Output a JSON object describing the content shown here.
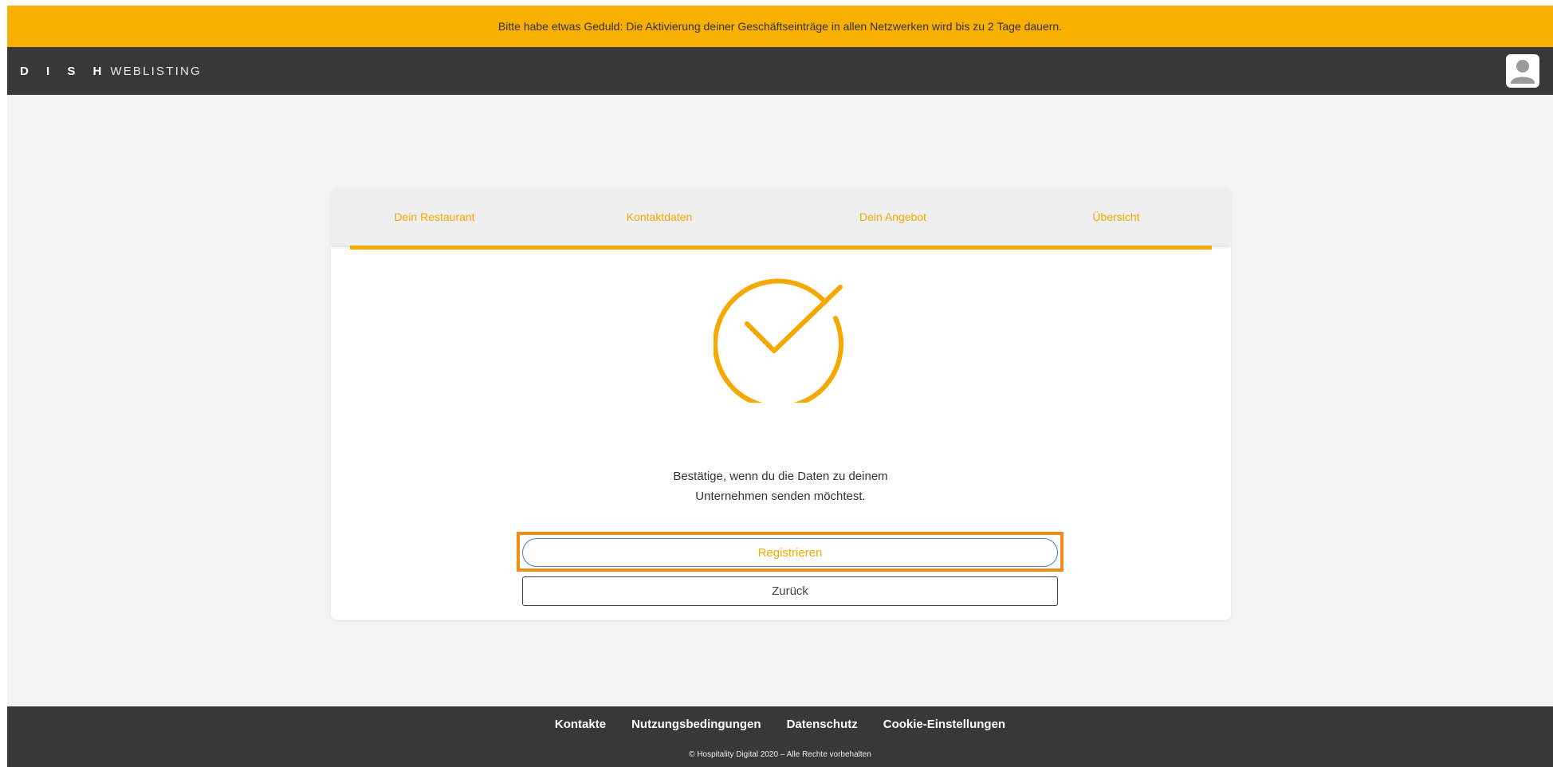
{
  "notice": {
    "text": "Bitte habe etwas Geduld: Die Aktivierung deiner Geschäftseinträge in allen Netzwerken wird bis zu 2 Tage dauern."
  },
  "header": {
    "brand": "D I S H",
    "product": "WEBLISTING",
    "avatar_icon": "user-icon"
  },
  "steps": [
    {
      "label": "Dein Restaurant"
    },
    {
      "label": "Kontaktdaten"
    },
    {
      "label": "Dein Angebot"
    },
    {
      "label": "Übersicht"
    }
  ],
  "progress": {
    "completed_fraction": 1.0
  },
  "success_icon": "checkmark-circle-icon",
  "confirm": {
    "line1": "Bestätige, wenn du die Daten zu deinem",
    "line2": "Unternehmen senden möchtest."
  },
  "buttons": {
    "register": "Registrieren",
    "back": "Zurück"
  },
  "footer": {
    "links": [
      "Kontakte",
      "Nutzungsbedingungen",
      "Datenschutz",
      "Cookie-Einstellungen"
    ],
    "copyright": "© Hospitality Digital 2020 – Alle Rechte vorbehalten"
  },
  "colors": {
    "accent": "#f5a800",
    "notice_bg": "#f9b000",
    "header_bg": "#383838",
    "highlight": "#f28c18",
    "primary_border": "#3f7fd6"
  }
}
